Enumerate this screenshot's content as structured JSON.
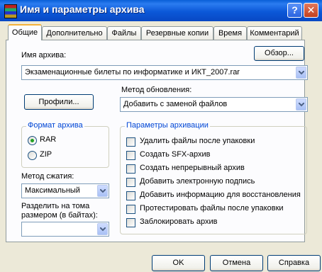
{
  "window": {
    "title": "Имя и параметры архива",
    "help_glyph": "?",
    "close_glyph": "✕"
  },
  "tabs": [
    {
      "label": "Общие",
      "active": true
    },
    {
      "label": "Дополнительно"
    },
    {
      "label": "Файлы"
    },
    {
      "label": "Резервные копии"
    },
    {
      "label": "Время"
    },
    {
      "label": "Комментарий"
    }
  ],
  "archive": {
    "name_label": "Имя архива:",
    "browse_label": "Обзор...",
    "name_value": "Экзаменационные билеты по информатике и ИКТ_2007.rar"
  },
  "profiles_label": "Профили...",
  "update_method": {
    "label": "Метод обновления:",
    "value": "Добавить с заменой файлов"
  },
  "format": {
    "title": "Формат архива",
    "options": [
      {
        "label": "RAR",
        "selected": true
      },
      {
        "label": "ZIP",
        "selected": false
      }
    ]
  },
  "compression": {
    "label": "Метод сжатия:",
    "value": "Максимальный"
  },
  "split": {
    "label_line1": "Разделить на тома",
    "label_line2": "размером (в байтах):",
    "value": ""
  },
  "archive_options": {
    "title": "Параметры архивации",
    "items": [
      {
        "label": "Удалить файлы после упаковки",
        "checked": false
      },
      {
        "label": "Создать SFX-архив",
        "checked": false
      },
      {
        "label": "Создать непрерывный архив",
        "checked": false
      },
      {
        "label": "Добавить электронную подпись",
        "checked": false
      },
      {
        "label": "Добавить информацию для восстановления",
        "checked": false
      },
      {
        "label": "Протестировать файлы после упаковки",
        "checked": false
      },
      {
        "label": "Заблокировать архив",
        "checked": false
      }
    ]
  },
  "footer": {
    "ok_label": "OK",
    "cancel_label": "Отмена",
    "help_label": "Справка"
  },
  "colors": {
    "titlebar": "#0b58d8",
    "group_title": "#0046d5",
    "active_tab_accent": "#f4b23a",
    "dialog_bg": "#ece9d8"
  }
}
